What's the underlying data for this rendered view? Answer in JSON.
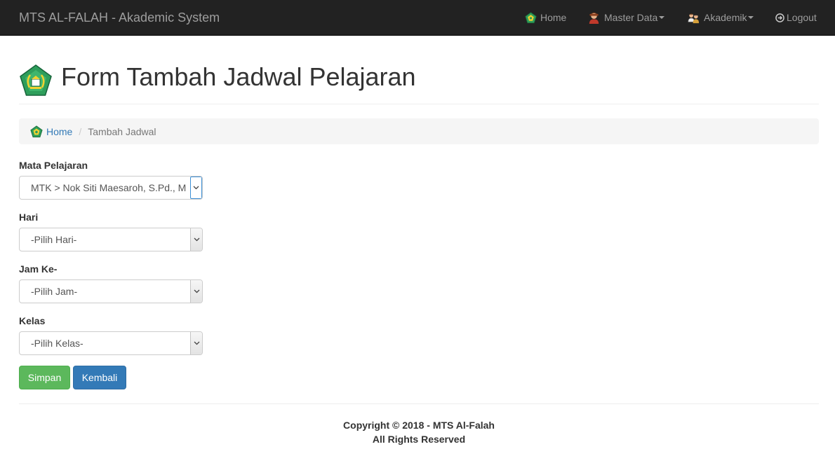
{
  "navbar": {
    "brand": "MTS AL-FALAH - Akademic System",
    "items": [
      {
        "label": "Home",
        "icon": "school-logo-icon"
      },
      {
        "label": "Master Data",
        "icon": "teacher-icon",
        "dropdown": true
      },
      {
        "label": "Akademik",
        "icon": "students-icon",
        "dropdown": true
      },
      {
        "label": "Logout",
        "icon": "logout-icon"
      }
    ]
  },
  "page": {
    "title": "Form Tambah Jadwal Pelajaran",
    "logo_icon": "school-logo-icon"
  },
  "breadcrumb": {
    "home": "Home",
    "separator": "/",
    "current": "Tambah Jadwal"
  },
  "form": {
    "mata_pelajaran": {
      "label": "Mata Pelajaran",
      "value": "MTK > Nok Siti Maesaroh, S.Pd., M"
    },
    "hari": {
      "label": "Hari",
      "value": "-Pilih Hari-"
    },
    "jam": {
      "label": "Jam Ke-",
      "value": "-Pilih Jam-"
    },
    "kelas": {
      "label": "Kelas",
      "value": "-Pilih Kelas-"
    }
  },
  "buttons": {
    "save": "Simpan",
    "back": "Kembali"
  },
  "footer": {
    "copyright": "Copyright © 2018 - MTS Al-Falah",
    "rights": "All Rights Reserved"
  },
  "colors": {
    "navbar_bg": "#222222",
    "success": "#5cb85c",
    "primary": "#337ab7",
    "link": "#337ab7"
  }
}
